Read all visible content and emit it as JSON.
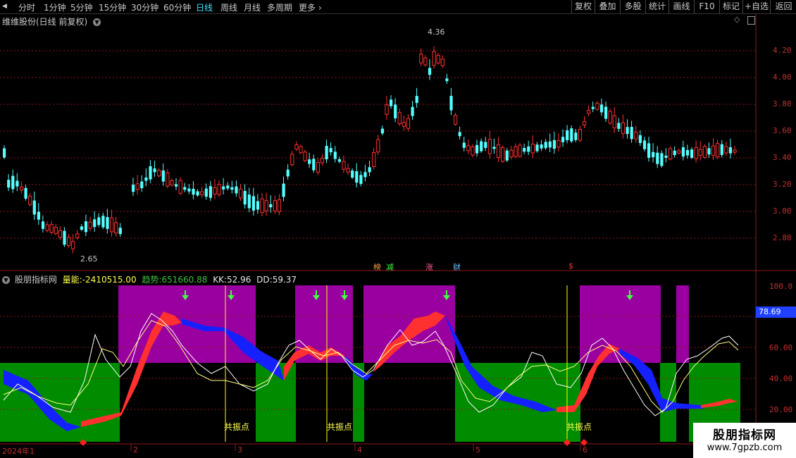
{
  "toolbar": {
    "periods": [
      "分时",
      "1分钟",
      "5分钟",
      "15分钟",
      "30分钟",
      "60分钟",
      "日线",
      "周线",
      "月线",
      "多周期",
      "更多"
    ],
    "active": "日线",
    "buttons": [
      "复权",
      "叠加",
      "多股",
      "统计",
      "画线",
      "F10",
      "标记",
      "+自选",
      "返回"
    ]
  },
  "main_panel": {
    "title": "维维股份(日线 前复权)",
    "y_ticks": [
      "4.20",
      "4.00",
      "3.80",
      "3.60",
      "3.40",
      "3.20",
      "3.00",
      "2.80"
    ],
    "high_label": "4.36",
    "low_label": "2.65",
    "markers": [
      "榜",
      "减",
      "涨",
      "财",
      "$"
    ],
    "colors": {
      "up": "#ff3030",
      "down": "#54ffff"
    }
  },
  "indicator_panel": {
    "name": "股朋指标网",
    "liang_label": "量能:",
    "liang_value": "-2410515.00",
    "qushi_label": "趋势:",
    "qushi_value": "651660.88",
    "kk_label": "KK:",
    "kk_value": "52.96",
    "dd_label": "DD:",
    "dd_value": "59.37",
    "y_ticks": [
      "100.0",
      "60.00",
      "40.00",
      "20.00"
    ],
    "current_value": "78.69",
    "resonance_label": "共振点"
  },
  "time_axis": [
    "2024年1",
    "2",
    "3",
    "4",
    "5",
    "6"
  ],
  "watermark": {
    "line1": "股朋指标网",
    "line2": "www.7gpzb.com"
  }
}
